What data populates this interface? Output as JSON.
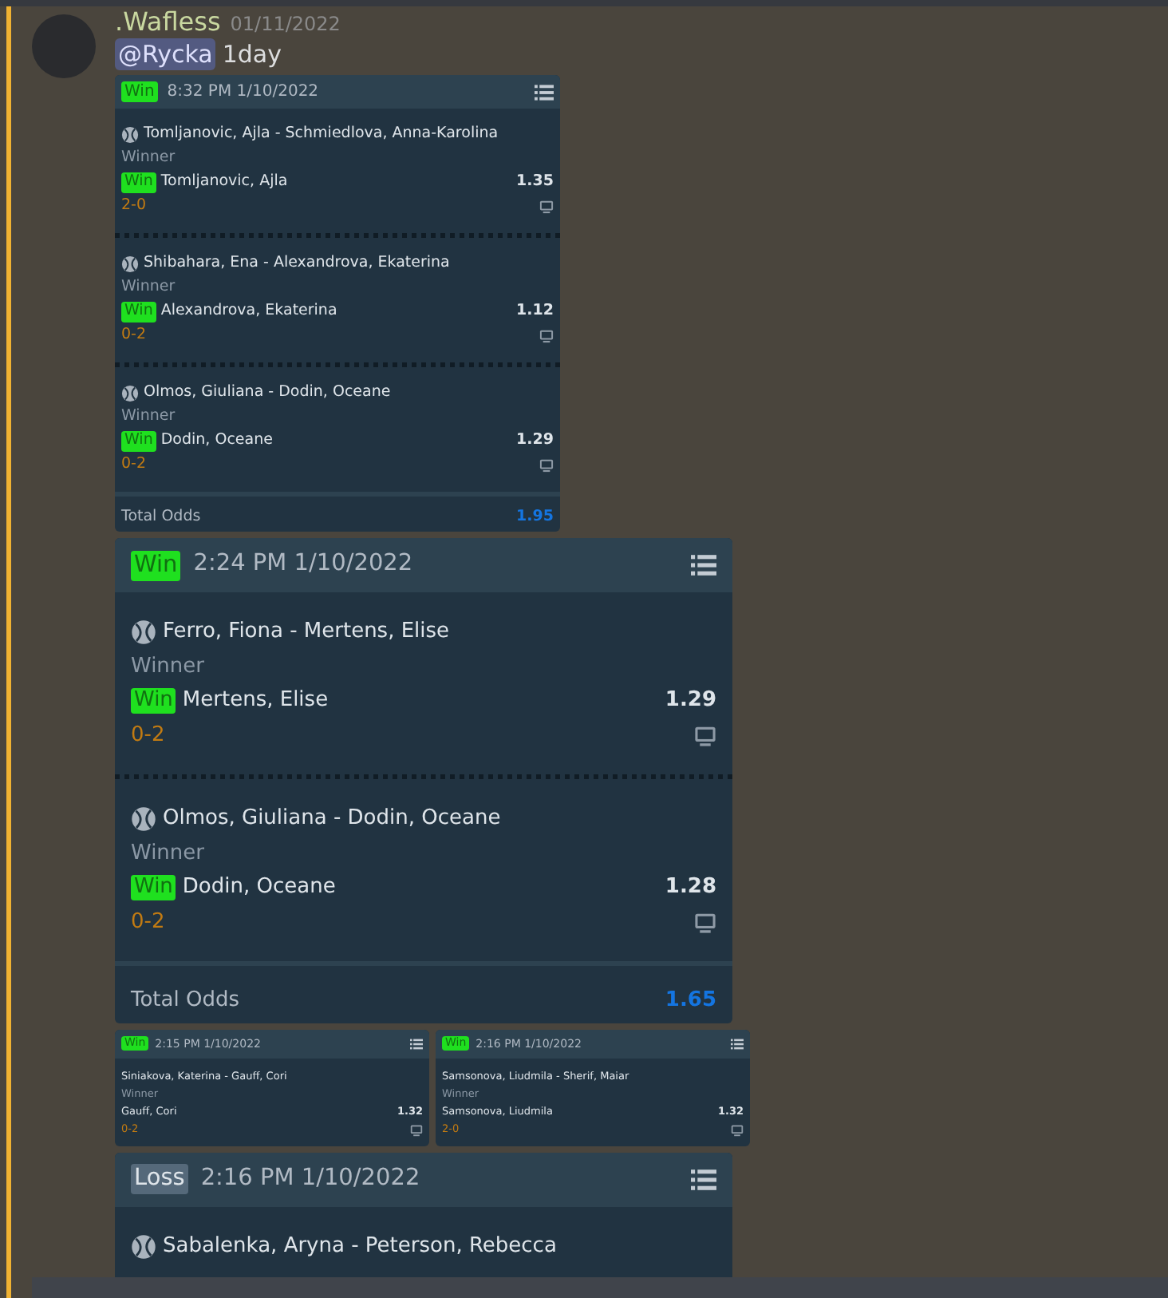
{
  "message": {
    "author": ".Wafless",
    "timestamp": "01/11/2022",
    "mention": "@Rycka",
    "text": "1day"
  },
  "slips": [
    {
      "badge": "Win",
      "won": true,
      "time": "8:32 PM 1/10/2022",
      "selections": [
        {
          "match": "Tomljanovic, Ajla - Schmiedlova, Anna-Karolina",
          "market": "Winner",
          "badge": "Win",
          "won": true,
          "pick": "Tomljanovic, Ajla",
          "odds": "1.35",
          "score": "2-0"
        },
        {
          "match": "Shibahara, Ena - Alexandrova, Ekaterina",
          "market": "Winner",
          "badge": "Win",
          "won": true,
          "pick": "Alexandrova, Ekaterina",
          "odds": "1.12",
          "score": "0-2"
        },
        {
          "match": "Olmos, Giuliana - Dodin, Oceane",
          "market": "Winner",
          "badge": "Win",
          "won": true,
          "pick": "Dodin, Oceane",
          "odds": "1.29",
          "score": "0-2"
        }
      ],
      "total_label": "Total Odds",
      "total": "1.95"
    },
    {
      "badge": "Win",
      "won": true,
      "time": "2:24 PM 1/10/2022",
      "selections": [
        {
          "match": "Ferro, Fiona - Mertens, Elise",
          "market": "Winner",
          "badge": "Win",
          "won": true,
          "pick": "Mertens, Elise",
          "odds": "1.29",
          "score": "0-2"
        },
        {
          "match": "Olmos, Giuliana - Dodin, Oceane",
          "market": "Winner",
          "badge": "Win",
          "won": true,
          "pick": "Dodin, Oceane",
          "odds": "1.28",
          "score": "0-2"
        }
      ],
      "total_label": "Total Odds",
      "total": "1.65"
    },
    {
      "badge": "Win",
      "won": true,
      "time": "2:15 PM 1/10/2022",
      "selections": [
        {
          "match": "Siniakova, Katerina - Gauff, Cori",
          "market": "Winner",
          "pick": "Gauff, Cori",
          "odds": "1.32",
          "score": "0-2"
        }
      ]
    },
    {
      "badge": "Win",
      "won": true,
      "time": "2:16 PM 1/10/2022",
      "selections": [
        {
          "match": "Samsonova, Liudmila - Sherif, Maiar",
          "market": "Winner",
          "pick": "Samsonova, Liudmila",
          "odds": "1.32",
          "score": "2-0"
        }
      ]
    },
    {
      "badge": "Loss",
      "won": false,
      "time": "2:16 PM 1/10/2022",
      "selections": [
        {
          "match": "Sabalenka, Aryna - Peterson, Rebecca"
        }
      ]
    }
  ]
}
